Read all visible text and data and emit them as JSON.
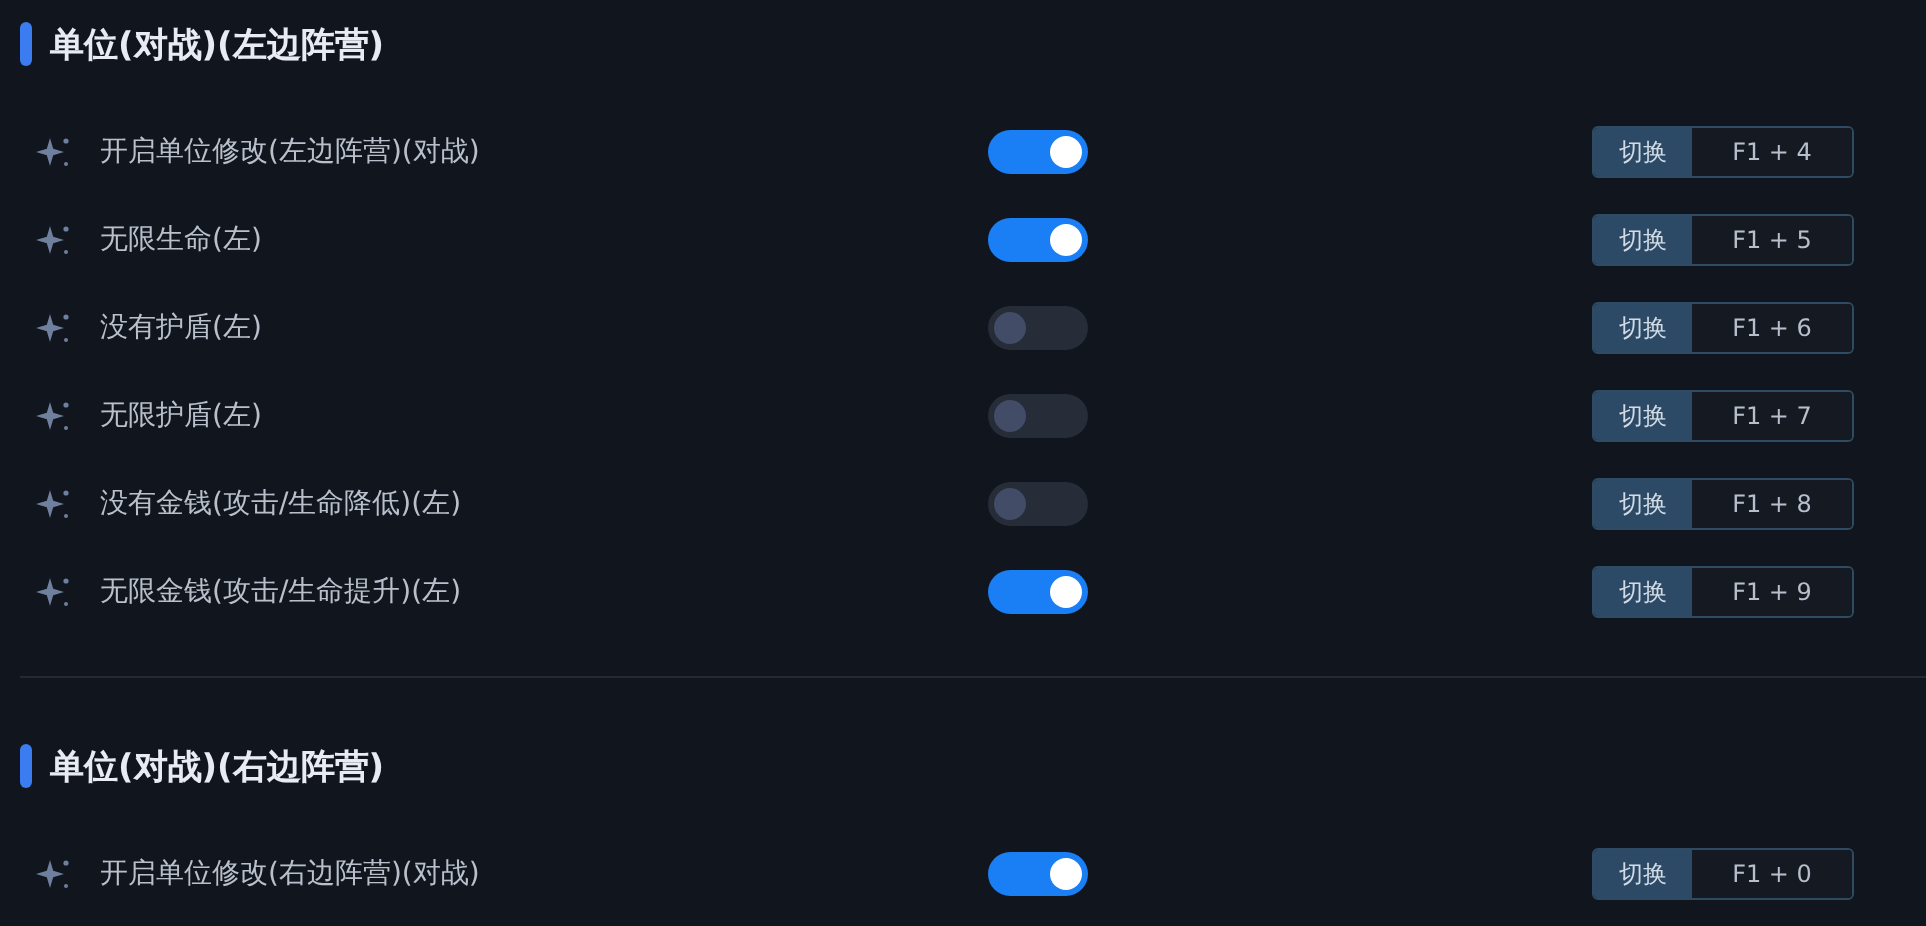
{
  "sections": [
    {
      "title": "单位(对战)(左边阵营)",
      "rows": [
        {
          "label": "开启单位修改(左边阵营)(对战)",
          "on": true,
          "action": "切换",
          "hotkey": "F1 + 4"
        },
        {
          "label": "无限生命(左)",
          "on": true,
          "action": "切换",
          "hotkey": "F1 + 5"
        },
        {
          "label": "没有护盾(左)",
          "on": false,
          "action": "切换",
          "hotkey": "F1 + 6"
        },
        {
          "label": "无限护盾(左)",
          "on": false,
          "action": "切换",
          "hotkey": "F1 + 7"
        },
        {
          "label": "没有金钱(攻击/生命降低)(左)",
          "on": false,
          "action": "切换",
          "hotkey": "F1 + 8"
        },
        {
          "label": "无限金钱(攻击/生命提升)(左)",
          "on": true,
          "action": "切换",
          "hotkey": "F1 + 9"
        }
      ]
    },
    {
      "title": "单位(对战)(右边阵营)",
      "rows": [
        {
          "label": "开启单位修改(右边阵营)(对战)",
          "on": true,
          "action": "切换",
          "hotkey": "F1 + 0"
        }
      ]
    }
  ]
}
